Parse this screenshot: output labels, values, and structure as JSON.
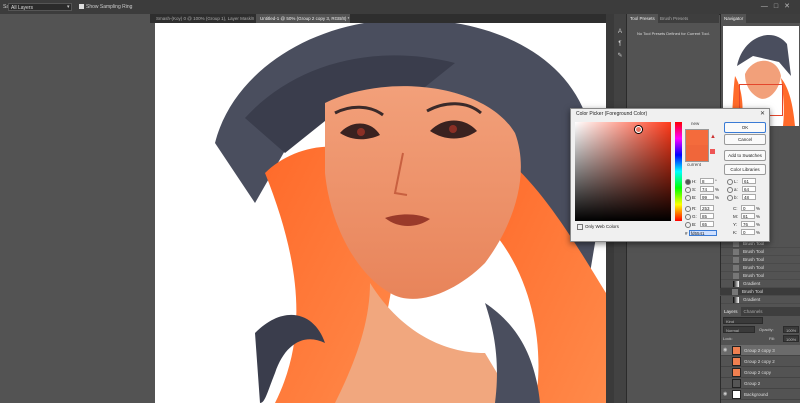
{
  "options_bar": {
    "sample_label": "Sample:",
    "sample_value": "All Layers",
    "show_ring_label": "Show Sampling Ring"
  },
  "window_controls": {
    "minimize": "—",
    "maximize": "□",
    "close": "✕"
  },
  "doc_tabs": [
    {
      "label": "Smash-(Koy) 0 @ 100% (Group 1), Layer Mask/8)",
      "active": false
    },
    {
      "label": "Untitled-1 @ 50% (Group 2 copy 3, RGB/8) *",
      "active": true
    }
  ],
  "side_icons": [
    "type-icon",
    "paragraph-icon",
    "tool-presets-icon"
  ],
  "tool_presets_panel": {
    "tabs": [
      "Tool Presets",
      "Brush Presets"
    ],
    "message": "No Tool Presets Defined for Current Tool."
  },
  "navigator": {
    "tab": "Navigator"
  },
  "history": [
    {
      "label": "Brush Tool",
      "icon": "brush-icon"
    },
    {
      "label": "Brush Tool",
      "icon": "brush-icon"
    },
    {
      "label": "Brush Tool",
      "icon": "brush-icon"
    },
    {
      "label": "Brush Tool",
      "icon": "brush-icon"
    },
    {
      "label": "Brush Tool",
      "icon": "brush-icon"
    },
    {
      "label": "Gradient",
      "icon": "gradient-icon"
    },
    {
      "label": "Gradient",
      "icon": "gradient-icon"
    },
    {
      "label": "Gradient",
      "icon": "gradient-icon"
    },
    {
      "label": "Brush Tool",
      "icon": "brush-icon",
      "selected": true
    }
  ],
  "layers_panel": {
    "tabs": [
      "Layers",
      "Channels"
    ],
    "kind_label": "Kind",
    "blend_mode": "Normal",
    "opacity_label": "Opacity:",
    "opacity_value": "100%",
    "lock_label": "Lock:",
    "fill_label": "Fill:",
    "fill_value": "100%",
    "layers": [
      {
        "name": "Group 2 copy 3",
        "selected": true
      },
      {
        "name": "Group 2 copy 2",
        "selected": false
      },
      {
        "name": "Group 2 copy",
        "selected": false
      },
      {
        "name": "Group 2",
        "selected": false
      },
      {
        "name": "Background",
        "selected": false
      }
    ]
  },
  "color_picker": {
    "title": "Color Picker (Foreground Color)",
    "new_label": "new",
    "current_label": "current",
    "new_color": "#f46b3c",
    "current_color": "#f0663a",
    "buttons": {
      "ok": "OK",
      "cancel": "Cancel",
      "add_swatches": "Add to Swatches",
      "libraries": "Color Libraries"
    },
    "hsb": [
      {
        "label": "H:",
        "value": "8",
        "unit": "°",
        "selected": true
      },
      {
        "label": "S:",
        "value": "74",
        "unit": "%"
      },
      {
        "label": "B:",
        "value": "99",
        "unit": "%"
      }
    ],
    "rgb": [
      {
        "label": "R:",
        "value": "253"
      },
      {
        "label": "G:",
        "value": "85"
      },
      {
        "label": "B:",
        "value": "65"
      }
    ],
    "lab": [
      {
        "label": "L:",
        "value": "61"
      },
      {
        "label": "a:",
        "value": "64"
      },
      {
        "label": "b:",
        "value": "48"
      }
    ],
    "cmyk": [
      {
        "label": "C:",
        "value": "0",
        "unit": "%"
      },
      {
        "label": "M:",
        "value": "81",
        "unit": "%"
      },
      {
        "label": "Y:",
        "value": "76",
        "unit": "%"
      },
      {
        "label": "K:",
        "value": "0",
        "unit": "%"
      }
    ],
    "web_only_label": "Only Web Colors",
    "hex_label": "#",
    "hex_value": "fd5541"
  }
}
